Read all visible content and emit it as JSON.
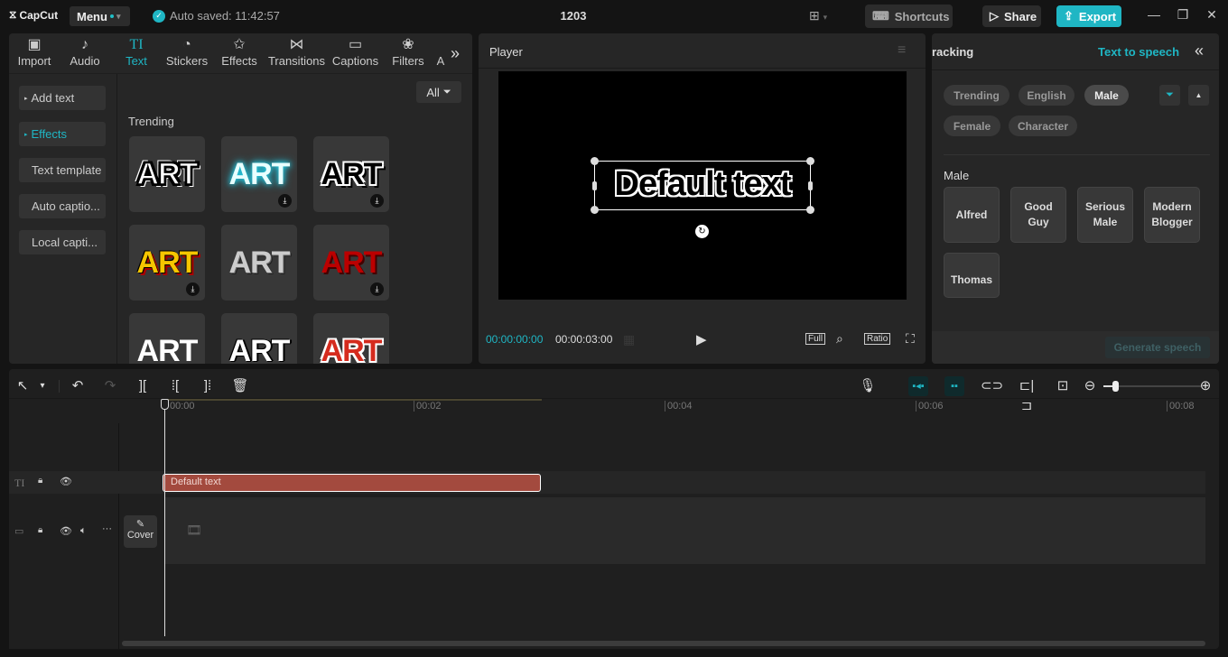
{
  "titlebar": {
    "app_name": "CapCut",
    "menu_label": "Menu",
    "autosave_text": "Auto saved: 11:42:57",
    "project_title": "1203",
    "shortcuts_label": "Shortcuts",
    "share_label": "Share",
    "export_label": "Export",
    "accent_color": "#1fb6c4"
  },
  "media_tabs": [
    {
      "label": "Import",
      "icon": "import-icon"
    },
    {
      "label": "Audio",
      "icon": "audio-icon"
    },
    {
      "label": "Text",
      "icon": "text-icon",
      "active": true
    },
    {
      "label": "Stickers",
      "icon": "sticker-icon"
    },
    {
      "label": "Effects",
      "icon": "effects-icon"
    },
    {
      "label": "Transitions",
      "icon": "transitions-icon"
    },
    {
      "label": "Captions",
      "icon": "captions-icon"
    },
    {
      "label": "Filters",
      "icon": "filters-icon"
    },
    {
      "label": "A",
      "icon": "adjustment-icon"
    }
  ],
  "text_sidebar": [
    {
      "label": "Add text",
      "arrow": true
    },
    {
      "label": "Effects",
      "arrow": true,
      "active": true
    },
    {
      "label": "Text template"
    },
    {
      "label": "Auto captio..."
    },
    {
      "label": "Local capti..."
    }
  ],
  "filter_label": "All",
  "section_title": "Trending",
  "effect_thumbs": [
    {
      "text": "ART",
      "style": "white-black-outline",
      "download": false
    },
    {
      "text": "ART",
      "style": "cyan-glow",
      "download": true
    },
    {
      "text": "ART",
      "style": "black-white-outline",
      "download": true
    },
    {
      "text": "ART",
      "style": "yellow-red-shadow",
      "download": true
    },
    {
      "text": "ART",
      "style": "silver-gradient",
      "download": false
    },
    {
      "text": "ART",
      "style": "dark-red",
      "download": true
    },
    {
      "text": "ART",
      "style": "plain-white",
      "download": false
    },
    {
      "text": "ART",
      "style": "sketch-outline",
      "download": false
    },
    {
      "text": "ART",
      "style": "red-white-outline",
      "download": false
    }
  ],
  "player": {
    "title": "Player",
    "canvas_text": "Default text",
    "current_time": "00:00:00:00",
    "total_time": "00:00:03:00",
    "full_label": "Full",
    "ratio_label": "Ratio"
  },
  "right_panel": {
    "tab_partial": "racking",
    "active_tab": "Text to speech",
    "filter_chips": [
      {
        "label": "Trending"
      },
      {
        "label": "English"
      },
      {
        "label": "Male",
        "active": true
      },
      {
        "label": "Female"
      },
      {
        "label": "Character"
      }
    ],
    "section_title": "Male",
    "voices": [
      "Alfred",
      "Good Guy",
      "Serious Male",
      "Modern Blogger",
      "Thomas"
    ],
    "generate_label": "Generate speech"
  },
  "timeline": {
    "ruler_labels": [
      "00:00",
      "00:02",
      "00:04",
      "00:06",
      "00:08"
    ],
    "text_clip_label": "Default text",
    "cover_label": "Cover",
    "clip_color": "#a34a3e",
    "zoom_level": 0.1
  }
}
